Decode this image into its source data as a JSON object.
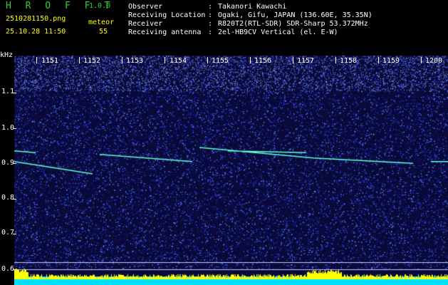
{
  "app": {
    "name": "H R O F F T",
    "version": "1.0.0"
  },
  "capture": {
    "filename": "2510281150.png",
    "datetime": "25.10.28 11:50"
  },
  "meteor": {
    "label": "meteor",
    "count": "55"
  },
  "station": [
    {
      "label": "Observer",
      "sep": ":",
      "value": "Takanori Kawachi"
    },
    {
      "label": "Receiving Location",
      "sep": ":",
      "value": "Ogaki, Gifu, JAPAN (136.60E, 35.35N)"
    },
    {
      "label": "Receiver",
      "sep": ":",
      "value": "R820T2(RTL-SDR) SDR-Sharp 53.372MHz"
    },
    {
      "label": "Receiving antenna",
      "sep": ":",
      "value": "2el-HB9CV Vertical (el. E-W)"
    }
  ],
  "spectrogram": {
    "y_unit": "kHz",
    "y_ticks": [
      "1.1",
      "1.0",
      "0.9",
      "0.8",
      "0.7",
      "0.6"
    ],
    "y_tick_values": [
      1.1,
      1.0,
      0.9,
      0.8,
      0.7,
      0.6
    ],
    "x_ticks": [
      "1151",
      "1152",
      "1153",
      "1154",
      "1155",
      "1156",
      "1157",
      "1158",
      "1159",
      "1200"
    ],
    "colors": {
      "background": "#0a0a3a",
      "noise": "#3050ff",
      "signal": "#60ffd0",
      "bar": "#00e0ff",
      "bar_top": "#ffff00"
    }
  }
}
